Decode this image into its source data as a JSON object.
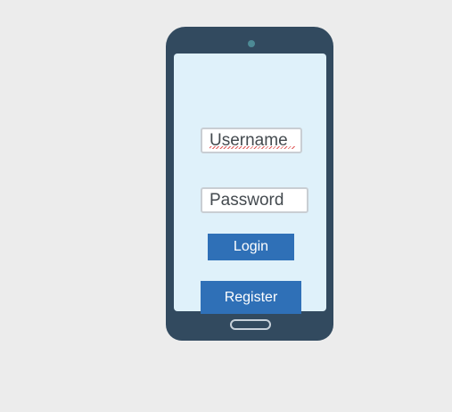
{
  "login_form": {
    "username_placeholder": "Username",
    "password_placeholder": "Password",
    "login_label": "Login",
    "register_label": "Register"
  },
  "colors": {
    "background": "#ececec",
    "phone_body": "#324a5f",
    "screen": "#dff1fa",
    "button": "#2f70b7",
    "spellcheck": "#e05a5a"
  }
}
